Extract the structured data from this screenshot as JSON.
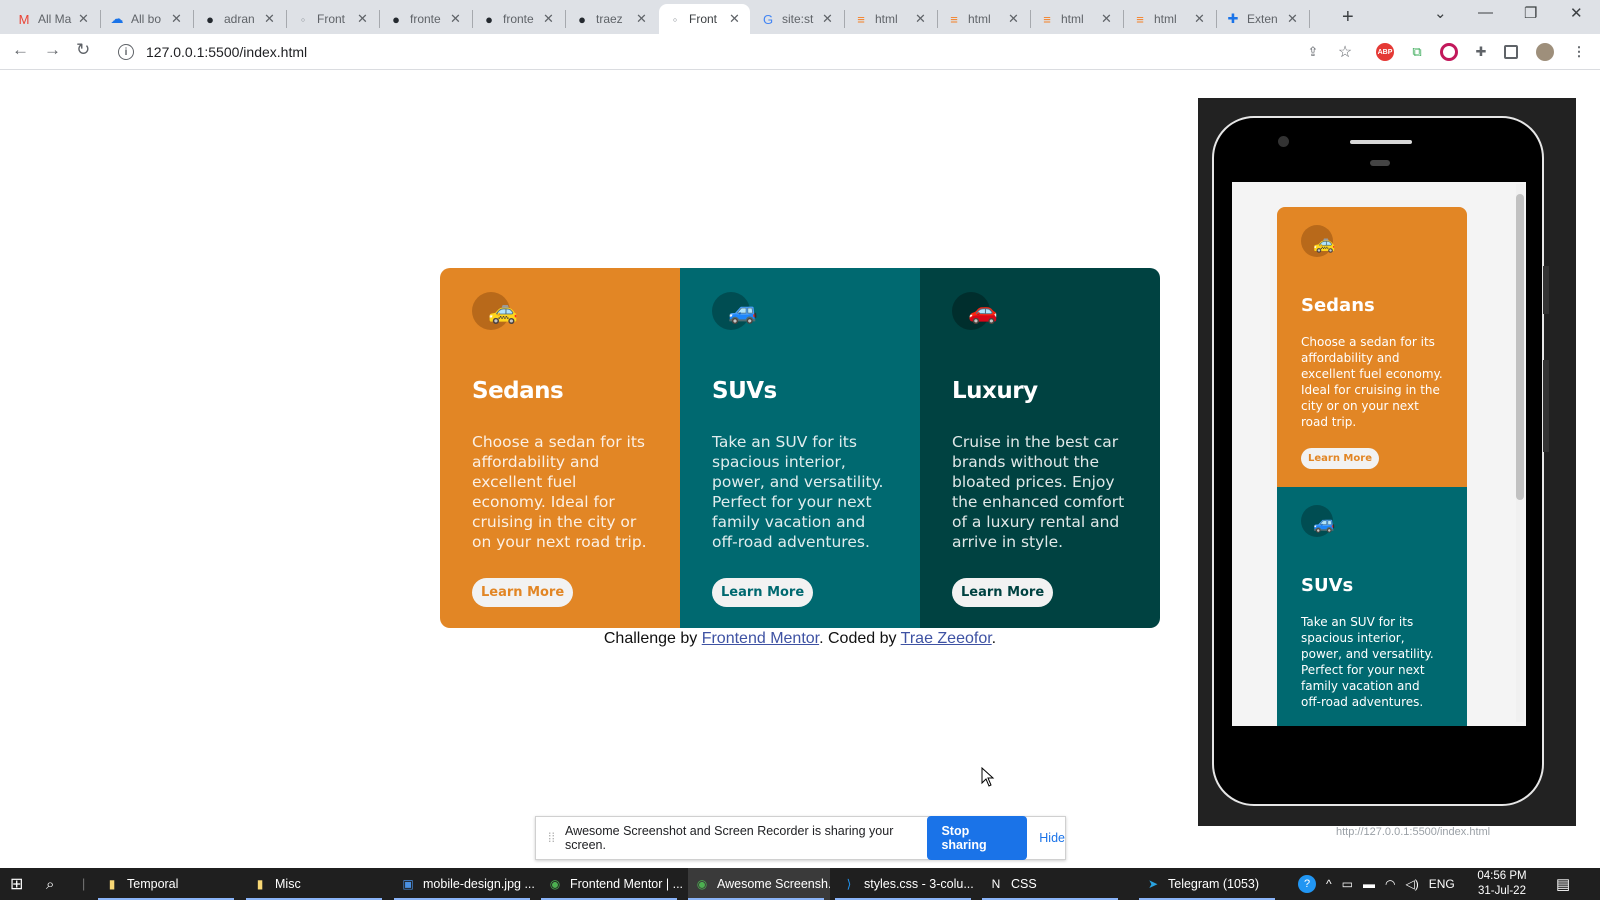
{
  "browser": {
    "tabs": [
      {
        "title": "All Ma",
        "icon": "gmail-icon",
        "color": "#ea4335"
      },
      {
        "title": "All bo",
        "icon": "cloud-icon",
        "color": "#1a73e8"
      },
      {
        "title": "adran",
        "icon": "github-icon",
        "color": "#24292f"
      },
      {
        "title": "Front",
        "icon": "frontend-mentor-icon",
        "color": "#9aa0a6"
      },
      {
        "title": "fronte",
        "icon": "github-icon",
        "color": "#24292f"
      },
      {
        "title": "fronte",
        "icon": "github-icon",
        "color": "#24292f"
      },
      {
        "title": "traez",
        "icon": "github-icon",
        "color": "#24292f"
      },
      {
        "title": "Front",
        "icon": "frontend-mentor-icon",
        "color": "#9aa0a6",
        "active": true
      },
      {
        "title": "site:st",
        "icon": "google-icon",
        "color": "#4285f4"
      },
      {
        "title": "html",
        "icon": "stackoverflow-icon",
        "color": "#f48024"
      },
      {
        "title": "html",
        "icon": "stackoverflow-icon",
        "color": "#f48024"
      },
      {
        "title": "html",
        "icon": "stackoverflow-icon",
        "color": "#f48024"
      },
      {
        "title": "html",
        "icon": "stackoverflow-icon",
        "color": "#f48024"
      },
      {
        "title": "Exten",
        "icon": "puzzle-icon",
        "color": "#1a73e8"
      }
    ],
    "url": "127.0.0.1:5500/index.html"
  },
  "cards": [
    {
      "title": "Sedans",
      "text": "Choose a sedan for its affordability and excellent fuel economy. Ideal for cruising in the city or on your next road trip.",
      "button": "Learn More",
      "bg": "#e28625",
      "icon": "sedan-icon"
    },
    {
      "title": "SUVs",
      "text": "Take an SUV for its spacious interior, power, and versatility. Perfect for your next family vacation and off-road adventures.",
      "button": "Learn More",
      "bg": "#006970",
      "icon": "suv-icon"
    },
    {
      "title": "Luxury",
      "text": "Cruise in the best car brands without the bloated prices. Enjoy the enhanced comfort of a luxury rental and arrive in style.",
      "button": "Learn More",
      "bg": "#004241",
      "icon": "luxury-car-icon"
    }
  ],
  "footer": {
    "prefix": "Challenge by ",
    "link1": "Frontend Mentor",
    "middle": ". Coded by ",
    "link2": "Trae Zeeofor",
    "suffix": "."
  },
  "phone_preview": {
    "url": "http://127.0.0.1:5500/index.html"
  },
  "share_bar": {
    "message": "Awesome Screenshot and Screen Recorder is sharing your screen.",
    "stop": "Stop sharing",
    "hide": "Hide"
  },
  "taskbar": {
    "items": [
      {
        "label": "Temporal",
        "icon": "folder-icon"
      },
      {
        "label": "Misc",
        "icon": "folder-icon"
      },
      {
        "label": "mobile-design.jpg ...",
        "icon": "image-viewer-icon"
      },
      {
        "label": "Frontend Mentor | ...",
        "icon": "chrome-icon"
      },
      {
        "label": "Awesome Screensh...",
        "icon": "chrome-icon",
        "active": true
      },
      {
        "label": "styles.css - 3-colu...",
        "icon": "vscode-icon"
      },
      {
        "label": "CSS",
        "icon": "notion-icon"
      },
      {
        "label": "Telegram (1053)",
        "icon": "telegram-icon"
      }
    ],
    "lang": "ENG",
    "time": "04:56 PM",
    "date": "31-Jul-22"
  }
}
